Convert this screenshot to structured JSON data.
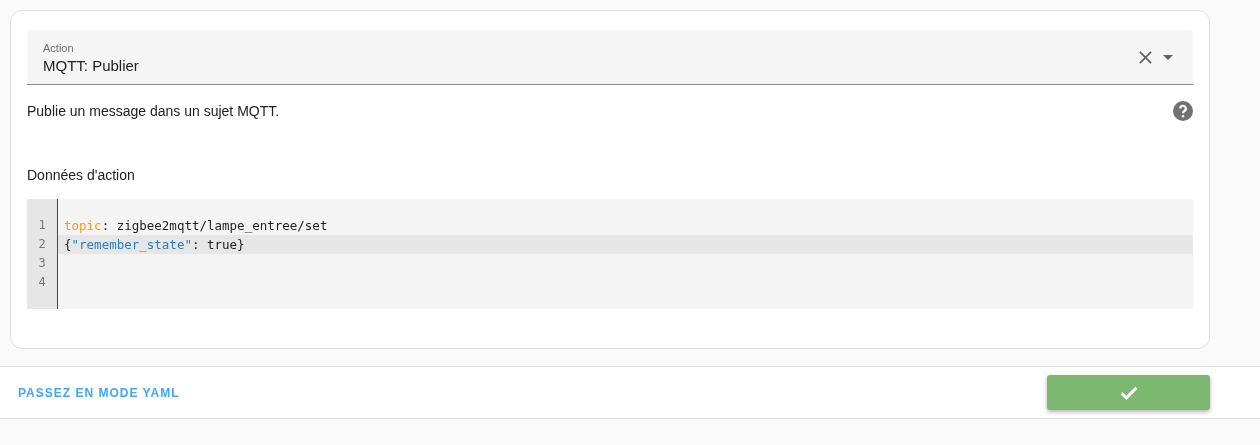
{
  "action_select": {
    "label": "Action",
    "value": "MQTT: Publier"
  },
  "description": "Publie un message dans un sujet MQTT.",
  "data_section": {
    "title": "Données d'action"
  },
  "code_editor": {
    "lines": [
      {
        "number": "1",
        "active": false,
        "tokens": [
          {
            "kind": "key",
            "text": "topic"
          },
          {
            "kind": "plain",
            "text": ": zigbee2mqtt/lampe_entree/set"
          }
        ]
      },
      {
        "number": "2",
        "active": true,
        "tokens": [
          {
            "kind": "plain",
            "text": "{"
          },
          {
            "kind": "string",
            "text": "\"remember_state\""
          },
          {
            "kind": "plain",
            "text": ": true}"
          }
        ]
      },
      {
        "number": "3",
        "active": false
      },
      {
        "number": "4",
        "active": false
      }
    ]
  },
  "footer": {
    "yaml_link": "PASSEZ EN MODE YAML"
  }
}
